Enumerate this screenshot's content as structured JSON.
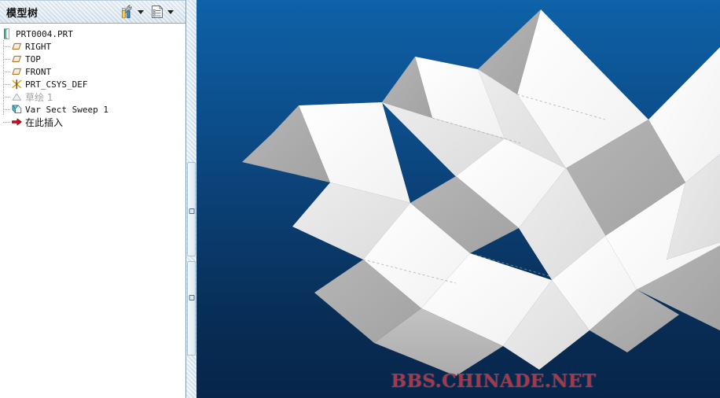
{
  "panel": {
    "title": "模型树",
    "tools": [
      {
        "name": "settings-tools-icon",
        "label": "设置",
        "has_caret": true
      },
      {
        "name": "tree-columns-icon",
        "label": "显示",
        "has_caret": true
      }
    ]
  },
  "tree": {
    "items": [
      {
        "label": "PRT0004.PRT",
        "icon": "part-icon",
        "depth": 0,
        "dim": false,
        "cjk": false
      },
      {
        "label": "RIGHT",
        "icon": "datum-plane-icon",
        "depth": 1,
        "dim": false,
        "cjk": false
      },
      {
        "label": "TOP",
        "icon": "datum-plane-icon",
        "depth": 1,
        "dim": false,
        "cjk": false
      },
      {
        "label": "FRONT",
        "icon": "datum-plane-icon",
        "depth": 1,
        "dim": false,
        "cjk": false
      },
      {
        "label": "PRT_CSYS_DEF",
        "icon": "coord-system-icon",
        "depth": 1,
        "dim": false,
        "cjk": false
      },
      {
        "label": "草绘 1",
        "icon": "sketch-icon",
        "depth": 1,
        "dim": true,
        "cjk": true
      },
      {
        "label": "Var Sect Sweep 1",
        "icon": "sweep-icon",
        "depth": 1,
        "dim": false,
        "cjk": false
      },
      {
        "label": "在此插入",
        "icon": "insert-here-icon",
        "depth": 1,
        "dim": false,
        "cjk": true
      }
    ]
  },
  "viewport": {
    "watermark": "BBS.CHINADE.NET",
    "background_top_color": "#0e62a8",
    "background_bottom_color": "#07254a",
    "model_face_light": "#ffffff",
    "model_face_mid": "#e3e3e3",
    "model_face_dark": "#aaaaaa",
    "model_name": "Var Sect Sweep folded surface"
  },
  "colors": {
    "accent": "#0e62a8",
    "watermark": "#a03a4c",
    "panel_header": "#dde8f0",
    "tree_background": "#ffffff"
  }
}
